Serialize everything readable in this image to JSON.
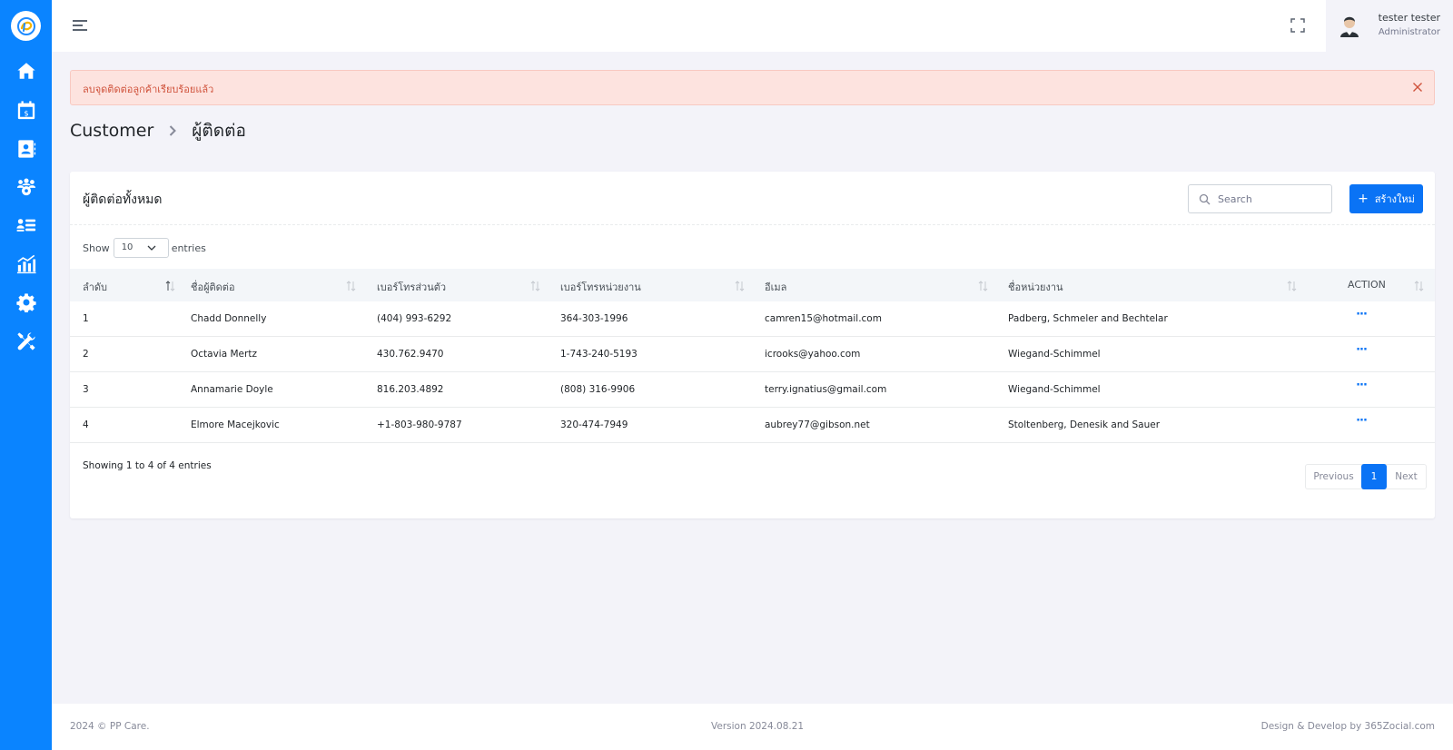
{
  "colors": {
    "sidebar": "#0a84ff",
    "primary": "#0a73f5",
    "alert_bg": "#fde3df",
    "alert_text": "#d0533c"
  },
  "sidebar": {
    "items": [
      {
        "icon": "home-icon"
      },
      {
        "icon": "calendar-dollar-icon"
      },
      {
        "icon": "contact-book-icon"
      },
      {
        "icon": "users-gear-icon"
      },
      {
        "icon": "user-list-icon"
      },
      {
        "icon": "chart-bar-icon"
      },
      {
        "icon": "gear-icon"
      },
      {
        "icon": "tools-icon"
      }
    ]
  },
  "header": {
    "user_name": "tester tester",
    "user_role": "Administrator"
  },
  "alert": {
    "message": "ลบจุดติดต่อลูกค้าเรียบร้อยแล้ว"
  },
  "breadcrumb": {
    "parent": "Customer",
    "current": "ผู้ติดต่อ"
  },
  "card": {
    "title": "ผู้ติดต่อทั้งหมด",
    "search_placeholder": "Search",
    "create_label": "สร้างใหม่",
    "show_label": "Show",
    "page_size": "10",
    "entries_label": "entries"
  },
  "table": {
    "columns": [
      "ลำดับ",
      "ชื่อผู้ติดต่อ",
      "เบอร์โทรส่วนตัว",
      "เบอร์โทรหน่วยงาน",
      "อีเมล",
      "ชื่อหน่วยงาน",
      "ACTION"
    ],
    "rows": [
      [
        "1",
        "Chadd Donnelly",
        "(404) 993-6292",
        "364-303-1996",
        "camren15@hotmail.com",
        "Padberg, Schmeler and Bechtelar",
        "···"
      ],
      [
        "2",
        "Octavia Mertz",
        "430.762.9470",
        "1-743-240-5193",
        "icrooks@yahoo.com",
        "Wiegand-Schimmel",
        "···"
      ],
      [
        "3",
        "Annamarie Doyle",
        "816.203.4892",
        "(808) 316-9906",
        "terry.ignatius@gmail.com",
        "Wiegand-Schimmel",
        "···"
      ],
      [
        "4",
        "Elmore Macejkovic",
        "+1-803-980-9787",
        "320-474-7949",
        "aubrey77@gibson.net",
        "Stoltenberg, Denesik and Sauer",
        "···"
      ]
    ]
  },
  "pagination": {
    "info": "Showing 1 to 4 of 4 entries",
    "previous": "Previous",
    "current": "1",
    "next": "Next"
  },
  "footer": {
    "copyright": "2024 © PP Care.",
    "version": "Version 2024.08.21",
    "credit": "Design & Develop by 365Zocial.com"
  }
}
